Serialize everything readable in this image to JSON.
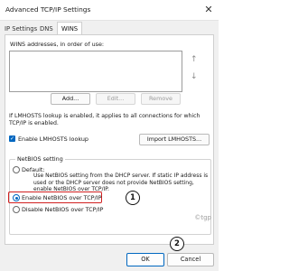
{
  "window": {
    "title": "Advanced TCP/IP Settings",
    "close_glyph": "✕"
  },
  "tabs": [
    {
      "label": "IP Settings"
    },
    {
      "label": "DNS"
    },
    {
      "label": "WINS",
      "active": true
    }
  ],
  "wins": {
    "list_label": "WINS addresses, in order of use:",
    "add_label": "Add...",
    "edit_label": "Edit...",
    "remove_label": "Remove",
    "up_glyph": "↑",
    "down_glyph": "↓"
  },
  "lmhosts": {
    "note": "If LMHOSTS lookup is enabled, it applies to all connections for which TCP/IP is enabled.",
    "enable_label": "Enable LMHOSTS lookup",
    "enable_checked": true,
    "import_label": "Import LMHOSTS..."
  },
  "netbios": {
    "group_title": "NetBIOS setting",
    "default_label": "Default:",
    "default_description": "Use NetBIOS setting from the DHCP server. If static IP address is used or the DHCP server does not provide NetBIOS setting, enable NetBIOS over TCP/IP.",
    "enable_label": "Enable NetBIOS over TCP/IP",
    "disable_label": "Disable NetBIOS over TCP/IP",
    "selected": "enable"
  },
  "annotations": {
    "badge1": "1",
    "badge2": "2",
    "accent_color": "#d12020"
  },
  "watermark": "©tgp",
  "footer": {
    "ok_label": "OK",
    "cancel_label": "Cancel"
  }
}
